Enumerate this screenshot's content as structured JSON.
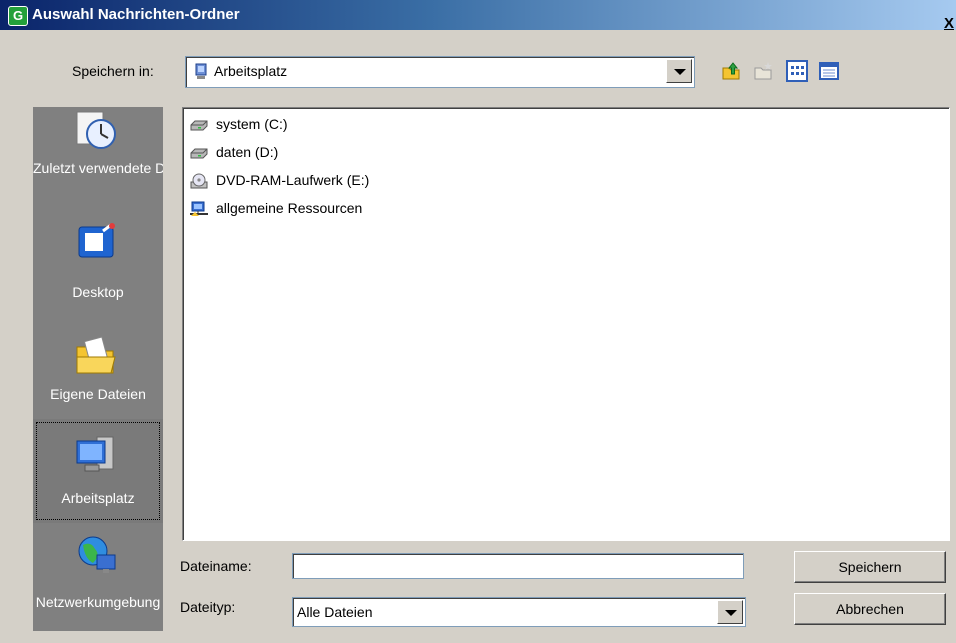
{
  "window": {
    "title": "Auswahl Nachrichten-Ordner",
    "close_label": "X"
  },
  "toolbar": {
    "save_in_label": "Speichern in:",
    "location": "Arbeitsplatz",
    "icons": [
      "up-folder-icon",
      "new-folder-icon",
      "list-view-icon",
      "details-view-icon"
    ]
  },
  "places": [
    {
      "label": "Zuletzt verwendete Dokumente",
      "icon": "recent-documents-icon"
    },
    {
      "label": "Desktop",
      "icon": "desktop-icon"
    },
    {
      "label": "Eigene Dateien",
      "icon": "my-documents-icon"
    },
    {
      "label": "Arbeitsplatz",
      "icon": "my-computer-icon",
      "selected": true
    },
    {
      "label": "Netzwerkumgebung",
      "icon": "network-icon"
    }
  ],
  "files": [
    {
      "label": "system (C:)",
      "icon": "hard-drive-icon"
    },
    {
      "label": "daten (D:)",
      "icon": "hard-drive-icon"
    },
    {
      "label": "DVD-RAM-Laufwerk (E:)",
      "icon": "dvd-drive-icon"
    },
    {
      "label": "allgemeine Ressourcen",
      "icon": "shared-resources-icon"
    }
  ],
  "bottom": {
    "filename_label": "Dateiname:",
    "filename_value": "",
    "filetype_label": "Dateityp:",
    "filetype_value": "Alle Dateien",
    "save_button": "Speichern",
    "cancel_button": "Abbrechen"
  },
  "colors": {
    "titlebar_start": "#0a246a",
    "titlebar_end": "#a6caf0",
    "dialog_bg": "#d4d0c8",
    "places_bg": "#808080"
  }
}
